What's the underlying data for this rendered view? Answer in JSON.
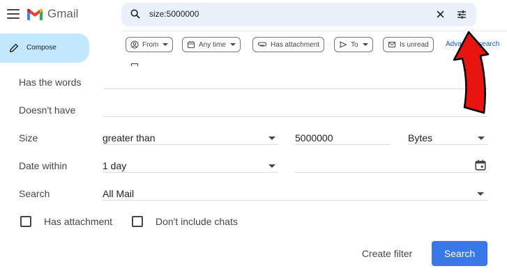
{
  "header": {
    "app_name": "Gmail",
    "search_query": "size:5000000"
  },
  "sidebar": {
    "compose_label": "Compose"
  },
  "chips": {
    "from": "From",
    "any_time": "Any time",
    "has_attachment": "Has attachment",
    "to": "To",
    "is_unread": "Is unread",
    "advanced_search": "Advanced search"
  },
  "form": {
    "has_words_label": "Has the words",
    "has_words_value": "",
    "doesnt_have_label": "Doesn't have",
    "doesnt_have_value": "",
    "size_label": "Size",
    "size_operator": "greater than",
    "size_value": "5000000",
    "size_unit": "Bytes",
    "date_within_label": "Date within",
    "date_within_value": "1 day",
    "date_value": "",
    "search_label": "Search",
    "search_scope": "All Mail",
    "has_attachment_label": "Has attachment",
    "has_attachment_checked": false,
    "no_chats_label": "Don't include chats",
    "no_chats_checked": false
  },
  "actions": {
    "create_filter": "Create filter",
    "search": "Search"
  },
  "colors": {
    "accent": "#3b78e7",
    "compose_bg": "#c2e7ff",
    "search_bg": "#eaf1fb",
    "link": "#0b57d0",
    "annotation_arrow": "#e8140e"
  }
}
